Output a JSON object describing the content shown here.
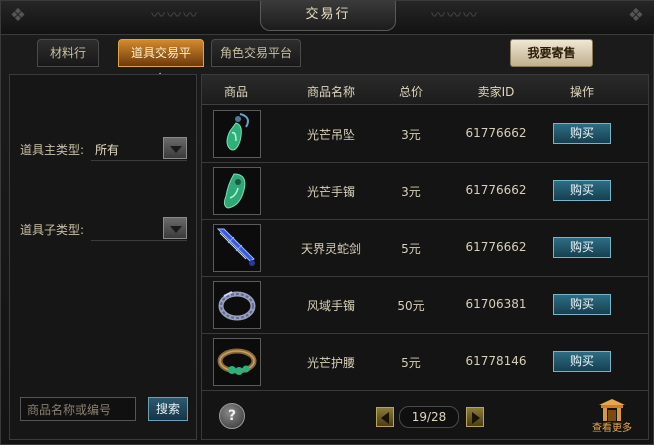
{
  "window": {
    "title": "交易行"
  },
  "tabs": [
    {
      "label": "材料行",
      "active": false
    },
    {
      "label": "道具交易平台",
      "active": true
    },
    {
      "label": "角色交易平台",
      "active": false
    }
  ],
  "sell_button": "我要寄售",
  "filters": {
    "main_type_label": "道具主类型:",
    "main_type_value": "所有",
    "sub_type_label": "道具子类型:",
    "sub_type_value": ""
  },
  "search": {
    "placeholder": "商品名称或编号",
    "button": "搜索"
  },
  "table": {
    "headers": [
      "商品",
      "商品名称",
      "总价",
      "卖家ID",
      "操作"
    ],
    "rows": [
      {
        "icon": "pendant-icon",
        "name": "光芒吊坠",
        "price": "3元",
        "seller": "61776662",
        "action": "购买"
      },
      {
        "icon": "bracelet-icon",
        "name": "光芒手镯",
        "price": "3元",
        "seller": "61776662",
        "action": "购买"
      },
      {
        "icon": "sword-icon",
        "name": "天界灵蛇剑",
        "price": "5元",
        "seller": "61776662",
        "action": "购买"
      },
      {
        "icon": "bangle-icon",
        "name": "风域手镯",
        "price": "50元",
        "seller": "61706381",
        "action": "购买"
      },
      {
        "icon": "belt-icon",
        "name": "光芒护腰",
        "price": "5元",
        "seller": "61778146",
        "action": "购买"
      }
    ]
  },
  "pagination": {
    "text": "19/28"
  },
  "help_label": "?",
  "more_label": "查看更多",
  "colors": {
    "accent": "#d48a2a",
    "buy": "#2d6d84",
    "jade": "#2fb07a"
  }
}
